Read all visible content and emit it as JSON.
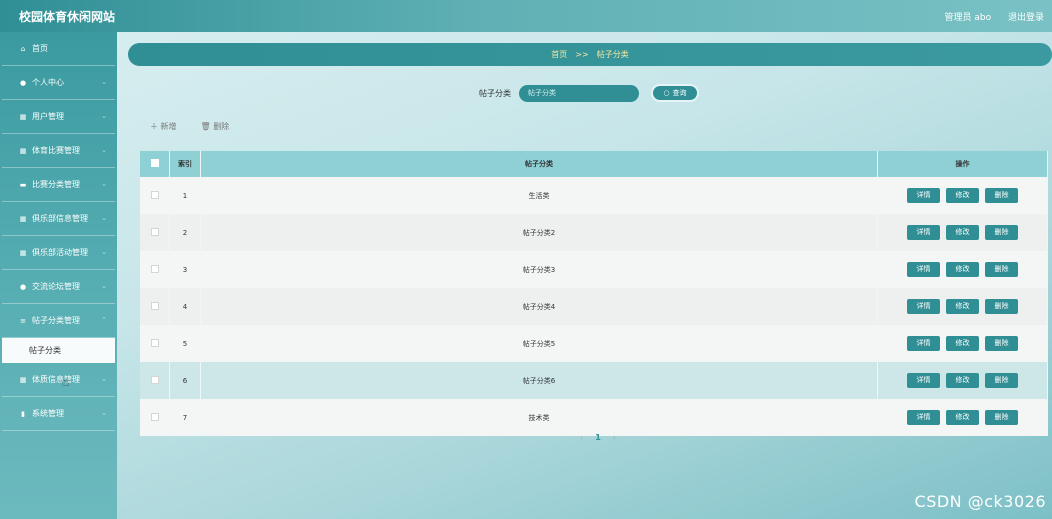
{
  "app": {
    "title": "校园体育休闲网站"
  },
  "topbar": {
    "user": "管理员 abo",
    "logout": "退出登录"
  },
  "sidebar": {
    "items": [
      {
        "label": "首页",
        "icon": "home-icon",
        "glyph": "⌂"
      },
      {
        "label": "个人中心",
        "icon": "user-icon",
        "glyph": "●"
      },
      {
        "label": "用户管理",
        "icon": "grid-icon",
        "glyph": "▦"
      },
      {
        "label": "体育比赛管理",
        "icon": "grid-icon",
        "glyph": "▦"
      },
      {
        "label": "比赛分类管理",
        "icon": "card-icon",
        "glyph": "▬"
      },
      {
        "label": "俱乐部信息管理",
        "icon": "grid-icon",
        "glyph": "▦"
      },
      {
        "label": "俱乐部活动管理",
        "icon": "grid-icon",
        "glyph": "▦"
      },
      {
        "label": "交流论坛管理",
        "icon": "user-icon",
        "glyph": "●"
      },
      {
        "label": "帖子分类管理",
        "icon": "list-icon",
        "glyph": "≡"
      },
      {
        "label": "体质信息管理",
        "icon": "table-icon",
        "glyph": "▦"
      },
      {
        "label": "系统管理",
        "icon": "chart-icon",
        "glyph": "▮"
      }
    ],
    "sub_item": "帖子分类"
  },
  "breadcrumb": {
    "home": "首页",
    "sep": ">>",
    "current": "帖子分类"
  },
  "search": {
    "label": "帖子分类",
    "placeholder": "帖子分类",
    "button": "查询"
  },
  "actions": {
    "add": "新增",
    "delete": "删除"
  },
  "table": {
    "headers": {
      "index": "索引",
      "category": "帖子分类",
      "ops": "操作"
    },
    "op_labels": {
      "detail": "详情",
      "edit": "修改",
      "delete": "删除"
    },
    "rows": [
      {
        "index": "1",
        "category": "生活类"
      },
      {
        "index": "2",
        "category": "帖子分类2"
      },
      {
        "index": "3",
        "category": "帖子分类3"
      },
      {
        "index": "4",
        "category": "帖子分类4"
      },
      {
        "index": "5",
        "category": "帖子分类5"
      },
      {
        "index": "6",
        "category": "帖子分类6"
      },
      {
        "index": "7",
        "category": "技术类"
      }
    ]
  },
  "pagination": {
    "prev": "‹",
    "page": "1",
    "next": "›"
  },
  "watermark": "CSDN @ck3026",
  "colors": {
    "accent": "#2f8f95",
    "header_bg": "#8fd0d5"
  }
}
